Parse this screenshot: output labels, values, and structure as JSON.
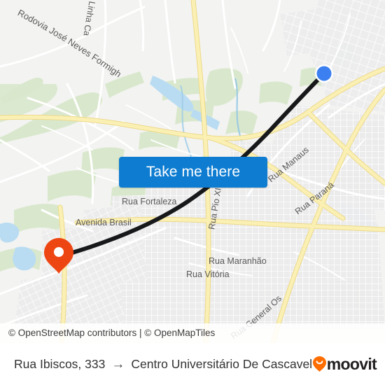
{
  "map": {
    "attribution": "© OpenStreetMap contributors | © OpenMapTiles",
    "street_labels": [
      "Rodovia José Neves Formighieri",
      "Linha Ca",
      "Rua Manaus",
      "Rua Paraná",
      "Rua Pio XII",
      "Rua Fortaleza",
      "Avenida Brasil",
      "Rua Maranhão",
      "Rua Vitória",
      "Rua General Osório"
    ],
    "origin_marker": {
      "name": "origin-pin",
      "color": "#ee4612"
    },
    "destination_marker": {
      "name": "destination-dot",
      "color": "#3b7ff0"
    },
    "route_line_color": "#1a1a1a"
  },
  "overlay": {
    "take_me_there_label": "Take me there",
    "button_color": "#0d7cd1"
  },
  "footer": {
    "origin": "Rua Ibiscos, 333",
    "arrow": "→",
    "destination": "Centro Universitário De Cascavel",
    "brand": "moovit",
    "brand_pin_color": "#ff6d00"
  }
}
